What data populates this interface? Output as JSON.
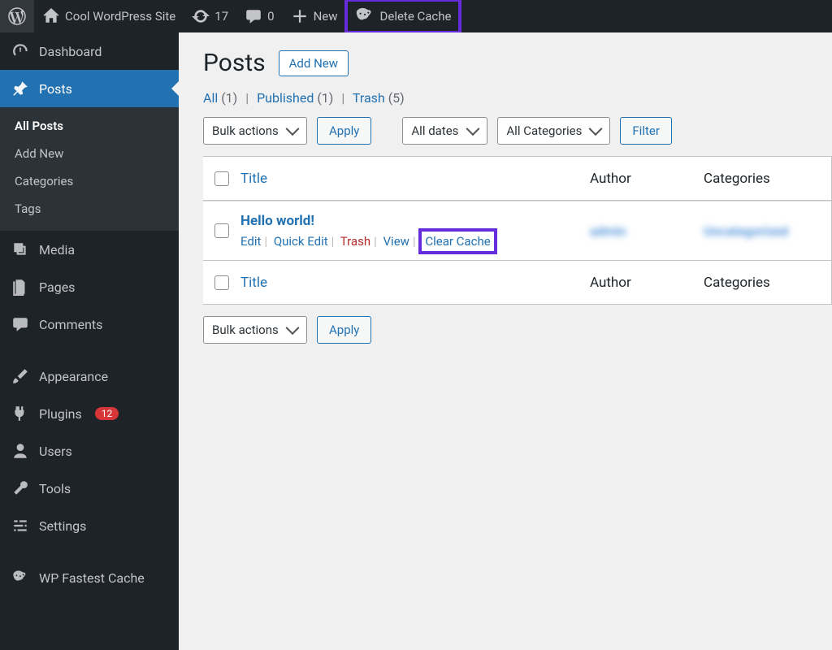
{
  "adminbar": {
    "site_name": "Cool WordPress Site",
    "updates_count": "17",
    "comments_count": "0",
    "new_label": "New",
    "delete_cache_label": "Delete Cache"
  },
  "sidebar": {
    "items": [
      {
        "id": "dashboard",
        "label": "Dashboard"
      },
      {
        "id": "posts",
        "label": "Posts"
      },
      {
        "id": "media",
        "label": "Media"
      },
      {
        "id": "pages",
        "label": "Pages"
      },
      {
        "id": "comments",
        "label": "Comments"
      },
      {
        "id": "appearance",
        "label": "Appearance"
      },
      {
        "id": "plugins",
        "label": "Plugins",
        "badge": "12"
      },
      {
        "id": "users",
        "label": "Users"
      },
      {
        "id": "tools",
        "label": "Tools"
      },
      {
        "id": "settings",
        "label": "Settings"
      },
      {
        "id": "wpfc",
        "label": "WP Fastest Cache"
      }
    ],
    "posts_submenu": [
      {
        "label": "All Posts",
        "current": true
      },
      {
        "label": "Add New"
      },
      {
        "label": "Categories"
      },
      {
        "label": "Tags"
      }
    ]
  },
  "page": {
    "title": "Posts",
    "add_new": "Add New",
    "filters": {
      "all_label": "All",
      "all_count": "(1)",
      "published_label": "Published",
      "published_count": "(1)",
      "trash_label": "Trash",
      "trash_count": "(5)"
    },
    "bulk_label": "Bulk actions",
    "apply_label": "Apply",
    "dates_label": "All dates",
    "cats_label": "All Categories",
    "filter_label": "Filter",
    "columns": {
      "title": "Title",
      "author": "Author",
      "categories": "Categories"
    },
    "row": {
      "title": "Hello world!",
      "edit": "Edit",
      "quick_edit": "Quick Edit",
      "trash": "Trash",
      "view": "View",
      "clear_cache": "Clear Cache",
      "author": "admin",
      "cats": "Uncategorized"
    }
  }
}
